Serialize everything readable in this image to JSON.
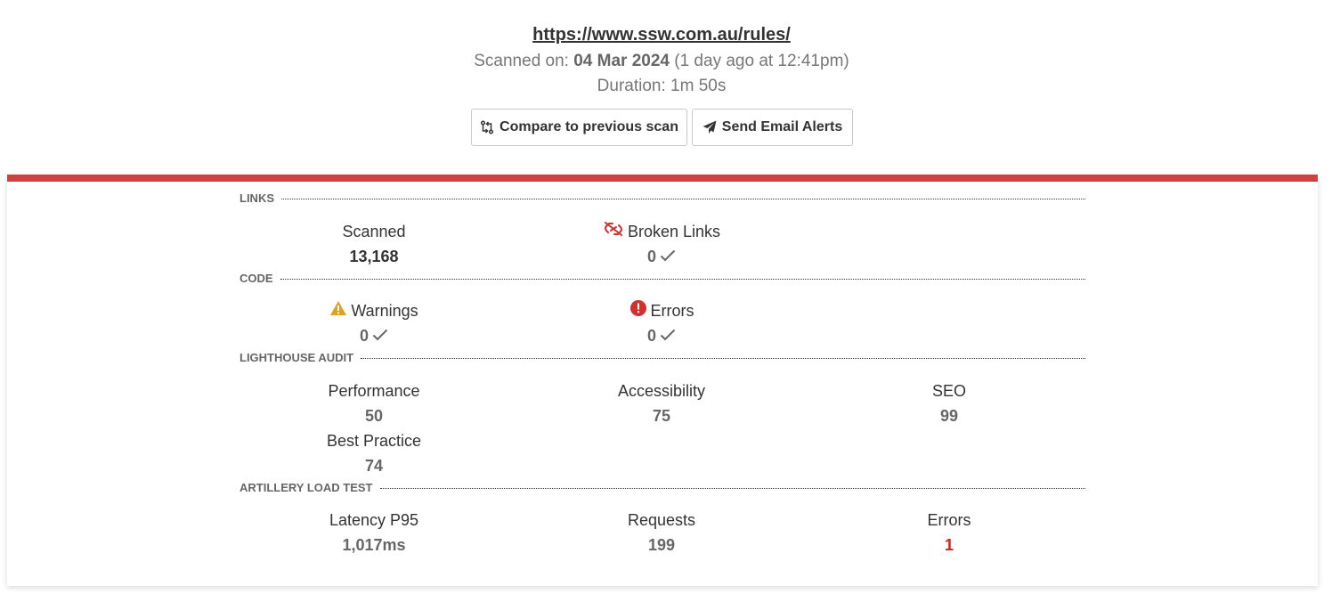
{
  "header": {
    "url": "https://www.ssw.com.au/rules/",
    "scanned_on_prefix": "Scanned on: ",
    "scanned_on_date": "04 Mar 2024",
    "scanned_on_relative": " (1 day ago at 12:41pm)",
    "duration": "Duration: 1m 50s"
  },
  "actions": {
    "compare_label": "Compare to previous scan",
    "email_label": "Send Email Alerts"
  },
  "colors": {
    "accent_bar": "#cc4141",
    "error_value": "#cc2222",
    "warning_icon": "#e0a020",
    "error_icon": "#d03030"
  },
  "sections": {
    "links": {
      "title": "LINKS",
      "scanned_label": "Scanned",
      "scanned_value": "13,168",
      "broken_label": "Broken Links",
      "broken_value": "0",
      "broken_icon": "broken-link-icon"
    },
    "code": {
      "title": "CODE",
      "warnings_label": "Warnings",
      "warnings_value": "0",
      "warnings_icon": "warning-icon",
      "errors_label": "Errors",
      "errors_value": "0",
      "errors_icon": "error-circle-icon"
    },
    "lighthouse": {
      "title": "LIGHTHOUSE AUDIT",
      "performance_label": "Performance",
      "performance_value": "50",
      "accessibility_label": "Accessibility",
      "accessibility_value": "75",
      "seo_label": "SEO",
      "seo_value": "99",
      "best_practice_label": "Best Practice",
      "best_practice_value": "74"
    },
    "artillery": {
      "title": "ARTILLERY LOAD TEST",
      "latency_label": "Latency P95",
      "latency_value": "1,017ms",
      "requests_label": "Requests",
      "requests_value": "199",
      "errors_label": "Errors",
      "errors_value": "1"
    }
  }
}
